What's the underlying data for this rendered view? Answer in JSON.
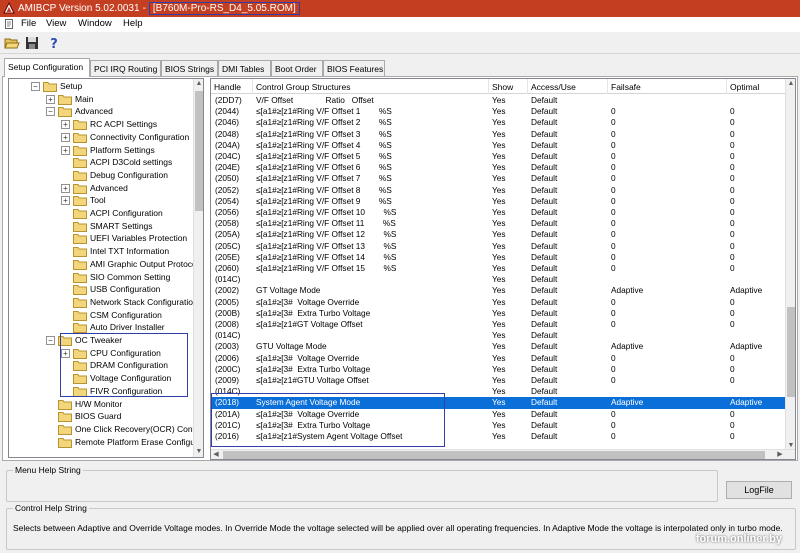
{
  "window": {
    "title": "AMIBCP Version 5.02.0031",
    "separator": "-",
    "rom_file": "[B760M-Pro-RS_D4_5.05.ROM]"
  },
  "menu": [
    "File",
    "View",
    "Window",
    "Help"
  ],
  "toolbar": {
    "buttons": [
      "open-folder-icon",
      "save-disk-icon",
      "help-icon"
    ]
  },
  "tabs": [
    "Setup Configuration",
    "PCI IRQ Routing",
    "BIOS Strings",
    "DMI Tables",
    "Boot Order",
    "BIOS Features"
  ],
  "tree": [
    {
      "label": "Setup",
      "depth": 0,
      "expander": "−"
    },
    {
      "label": "Main",
      "depth": 1,
      "expander": "+"
    },
    {
      "label": "Advanced",
      "depth": 1,
      "expander": "−"
    },
    {
      "label": "RC ACPI Settings",
      "depth": 2,
      "expander": "+"
    },
    {
      "label": "Connectivity Configuration",
      "depth": 2,
      "expander": "+"
    },
    {
      "label": "Platform Settings",
      "depth": 2,
      "expander": "+"
    },
    {
      "label": "ACPI D3Cold settings",
      "depth": 2,
      "expander": ""
    },
    {
      "label": "Debug Configuration",
      "depth": 2,
      "expander": ""
    },
    {
      "label": "Advanced",
      "depth": 2,
      "expander": "+"
    },
    {
      "label": "Tool",
      "depth": 2,
      "expander": "+"
    },
    {
      "label": "ACPI Configuration",
      "depth": 2,
      "expander": ""
    },
    {
      "label": "SMART Settings",
      "depth": 2,
      "expander": ""
    },
    {
      "label": "UEFI Variables Protection",
      "depth": 2,
      "expander": ""
    },
    {
      "label": "Intel TXT Information",
      "depth": 2,
      "expander": ""
    },
    {
      "label": "AMI Graphic Output Protocol",
      "depth": 2,
      "expander": ""
    },
    {
      "label": "SIO Common Setting",
      "depth": 2,
      "expander": ""
    },
    {
      "label": "USB Configuration",
      "depth": 2,
      "expander": ""
    },
    {
      "label": "Network Stack Configuration",
      "depth": 2,
      "expander": ""
    },
    {
      "label": "CSM Configuration",
      "depth": 2,
      "expander": ""
    },
    {
      "label": "Auto Driver Installer",
      "depth": 2,
      "expander": ""
    },
    {
      "label": "OC Tweaker",
      "depth": 1,
      "expander": "−"
    },
    {
      "label": "CPU Configuration",
      "depth": 2,
      "expander": "+"
    },
    {
      "label": "DRAM Configuration",
      "depth": 2,
      "expander": ""
    },
    {
      "label": "Voltage Configuration",
      "depth": 2,
      "expander": ""
    },
    {
      "label": "FIVR Configuration",
      "depth": 2,
      "expander": ""
    },
    {
      "label": "H/W Monitor",
      "depth": 1,
      "expander": ""
    },
    {
      "label": "BIOS Guard",
      "depth": 1,
      "expander": ""
    },
    {
      "label": "One Click Recovery(OCR) Configuration",
      "depth": 1,
      "expander": ""
    },
    {
      "label": "Remote Platform Erase Configuration",
      "depth": 1,
      "expander": ""
    }
  ],
  "grid": {
    "headers": [
      "Handle",
      "Control Group Structures",
      "Show",
      "Access/Use",
      "Failsafe",
      "Optimal"
    ],
    "rows": [
      {
        "handle": "(2DD7)",
        "structure": "V/F Offset              Ratio   Offset",
        "show": "Yes",
        "access": "Default",
        "failsafe": "",
        "optimal": ""
      },
      {
        "handle": "(2044)",
        "structure": "≤[a1#≥[z1#Ring V/F Offset 1        %S",
        "show": "Yes",
        "access": "Default",
        "failsafe": "0",
        "optimal": "0"
      },
      {
        "handle": "(2046)",
        "structure": "≤[a1#≥[z1#Ring V/F Offset 2        %S",
        "show": "Yes",
        "access": "Default",
        "failsafe": "0",
        "optimal": "0"
      },
      {
        "handle": "(2048)",
        "structure": "≤[a1#≥[z1#Ring V/F Offset 3        %S",
        "show": "Yes",
        "access": "Default",
        "failsafe": "0",
        "optimal": "0"
      },
      {
        "handle": "(204A)",
        "structure": "≤[a1#≥[z1#Ring V/F Offset 4        %S",
        "show": "Yes",
        "access": "Default",
        "failsafe": "0",
        "optimal": "0"
      },
      {
        "handle": "(204C)",
        "structure": "≤[a1#≥[z1#Ring V/F Offset 5        %S",
        "show": "Yes",
        "access": "Default",
        "failsafe": "0",
        "optimal": "0"
      },
      {
        "handle": "(204E)",
        "structure": "≤[a1#≥[z1#Ring V/F Offset 6        %S",
        "show": "Yes",
        "access": "Default",
        "failsafe": "0",
        "optimal": "0"
      },
      {
        "handle": "(2050)",
        "structure": "≤[a1#≥[z1#Ring V/F Offset 7        %S",
        "show": "Yes",
        "access": "Default",
        "failsafe": "0",
        "optimal": "0"
      },
      {
        "handle": "(2052)",
        "structure": "≤[a1#≥[z1#Ring V/F Offset 8        %S",
        "show": "Yes",
        "access": "Default",
        "failsafe": "0",
        "optimal": "0"
      },
      {
        "handle": "(2054)",
        "structure": "≤[a1#≥[z1#Ring V/F Offset 9        %S",
        "show": "Yes",
        "access": "Default",
        "failsafe": "0",
        "optimal": "0"
      },
      {
        "handle": "(2056)",
        "structure": "≤[a1#≥[z1#Ring V/F Offset 10        %S",
        "show": "Yes",
        "access": "Default",
        "failsafe": "0",
        "optimal": "0"
      },
      {
        "handle": "(2058)",
        "structure": "≤[a1#≥[z1#Ring V/F Offset 11        %S",
        "show": "Yes",
        "access": "Default",
        "failsafe": "0",
        "optimal": "0"
      },
      {
        "handle": "(205A)",
        "structure": "≤[a1#≥[z1#Ring V/F Offset 12        %S",
        "show": "Yes",
        "access": "Default",
        "failsafe": "0",
        "optimal": "0"
      },
      {
        "handle": "(205C)",
        "structure": "≤[a1#≥[z1#Ring V/F Offset 13        %S",
        "show": "Yes",
        "access": "Default",
        "failsafe": "0",
        "optimal": "0"
      },
      {
        "handle": "(205E)",
        "structure": "≤[a1#≥[z1#Ring V/F Offset 14        %S",
        "show": "Yes",
        "access": "Default",
        "failsafe": "0",
        "optimal": "0"
      },
      {
        "handle": "(2060)",
        "structure": "≤[a1#≥[z1#Ring V/F Offset 15        %S",
        "show": "Yes",
        "access": "Default",
        "failsafe": "0",
        "optimal": "0"
      },
      {
        "handle": "(014C)",
        "structure": "",
        "show": "Yes",
        "access": "Default",
        "failsafe": "",
        "optimal": ""
      },
      {
        "handle": "(2002)",
        "structure": "GT Voltage Mode",
        "show": "Yes",
        "access": "Default",
        "failsafe": "Adaptive",
        "optimal": "Adaptive"
      },
      {
        "handle": "(2005)",
        "structure": "≤[a1#≥[3#  Voltage Override",
        "show": "Yes",
        "access": "Default",
        "failsafe": "0",
        "optimal": "0"
      },
      {
        "handle": "(200B)",
        "structure": "≤[a1#≥[3#  Extra Turbo Voltage",
        "show": "Yes",
        "access": "Default",
        "failsafe": "0",
        "optimal": "0"
      },
      {
        "handle": "(2008)",
        "structure": "≤[a1#≥[z1#GT Voltage Offset",
        "show": "Yes",
        "access": "Default",
        "failsafe": "0",
        "optimal": "0"
      },
      {
        "handle": "(014C)",
        "structure": "",
        "show": "Yes",
        "access": "Default",
        "failsafe": "",
        "optimal": ""
      },
      {
        "handle": "(2003)",
        "structure": "GTU Voltage Mode",
        "show": "Yes",
        "access": "Default",
        "failsafe": "Adaptive",
        "optimal": "Adaptive"
      },
      {
        "handle": "(2006)",
        "structure": "≤[a1#≥[3#  Voltage Override",
        "show": "Yes",
        "access": "Default",
        "failsafe": "0",
        "optimal": "0"
      },
      {
        "handle": "(200C)",
        "structure": "≤[a1#≥[3#  Extra Turbo Voltage",
        "show": "Yes",
        "access": "Default",
        "failsafe": "0",
        "optimal": "0"
      },
      {
        "handle": "(2009)",
        "structure": "≤[a1#≥[z1#GTU Voltage Offset",
        "show": "Yes",
        "access": "Default",
        "failsafe": "0",
        "optimal": "0"
      },
      {
        "handle": "(014C)",
        "structure": "",
        "show": "Yes",
        "access": "Default",
        "failsafe": "",
        "optimal": ""
      },
      {
        "handle": "(2018)",
        "structure": "System Agent Voltage Mode",
        "show": "Yes",
        "access": "Default",
        "failsafe": "Adaptive",
        "optimal": "Adaptive",
        "selected": true
      },
      {
        "handle": "(201A)",
        "structure": "≤[a1#≥[3#  Voltage Override",
        "show": "Yes",
        "access": "Default",
        "failsafe": "0",
        "optimal": "0"
      },
      {
        "handle": "(201C)",
        "structure": "≤[a1#≥[3#  Extra Turbo Voltage",
        "show": "Yes",
        "access": "Default",
        "failsafe": "0",
        "optimal": "0"
      },
      {
        "handle": "(2016)",
        "structure": "≤[a1#≥[z1#System Agent Voltage Offset",
        "show": "Yes",
        "access": "Default",
        "failsafe": "0",
        "optimal": "0"
      }
    ]
  },
  "menu_help": {
    "title": "Menu Help String",
    "text": ""
  },
  "control_help": {
    "title": "Control Help String",
    "text": "Selects between Adaptive and Override Voltage modes. In Override Mode the voltage selected will be applied over all operating frequencies. In Adaptive Mode the voltage is interpolated only in turbo mode."
  },
  "logfile_button": "LogFile",
  "watermark": "forum.onliner.by",
  "colors": {
    "title_bar": "#c43f21",
    "selection": "#0a6fd8",
    "highlight_box": "#2f3ea8"
  }
}
